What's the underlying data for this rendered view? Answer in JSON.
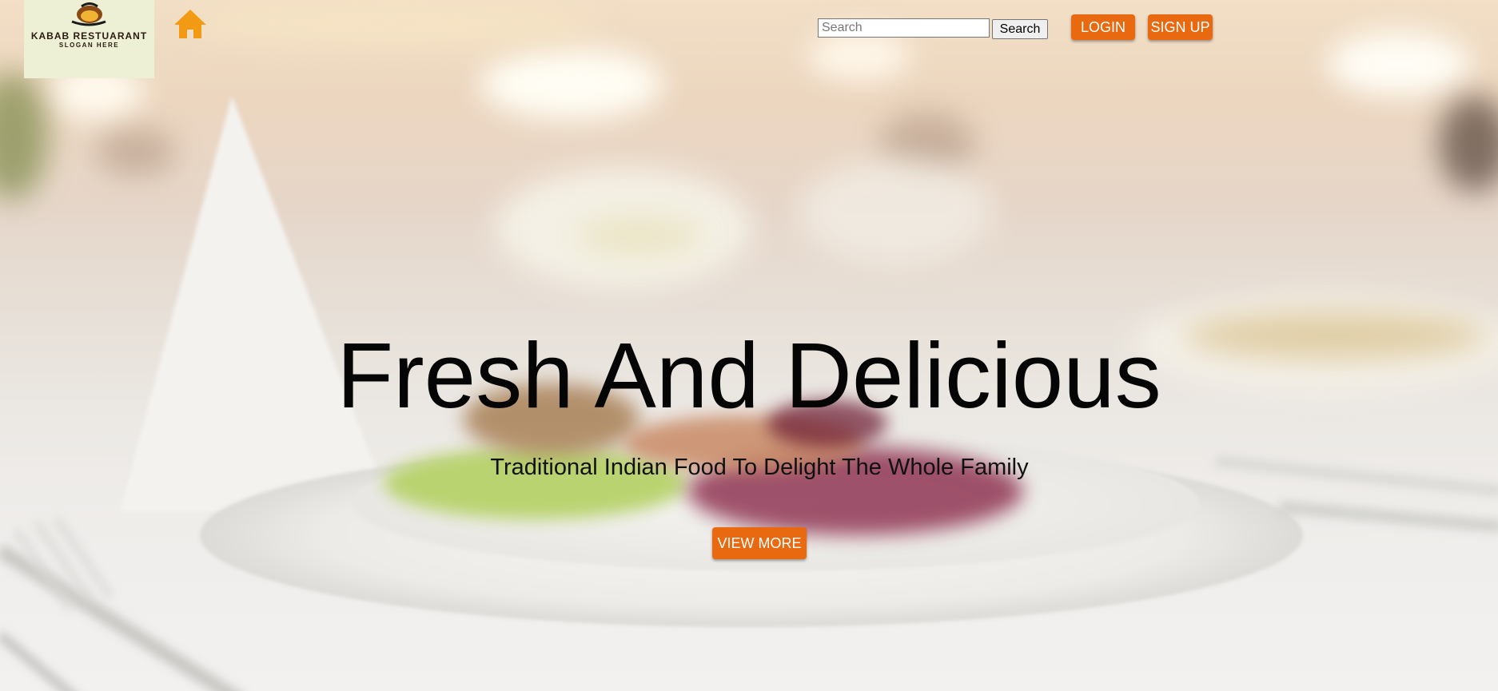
{
  "brand": {
    "name": "KABAB RESTUARANT",
    "slogan": "SLOGAN HERE",
    "logo_icon": "kabab-dish-icon"
  },
  "nav": {
    "home_icon": "home-icon"
  },
  "search": {
    "placeholder": "Search",
    "value": "",
    "button_label": "Search"
  },
  "auth": {
    "login_label": "LOGIN",
    "signup_label": "SIGN UP"
  },
  "hero": {
    "title": "Fresh And Delicious",
    "subtitle": "Traditional Indian Food To Delight The Whole Family",
    "cta_label": "VIEW MORE",
    "background": "restaurant-table-salad-plate-photo"
  },
  "colors": {
    "accent": "#e8690f",
    "home_icon": "#f39a14",
    "logo_bg": "#eef0d6"
  }
}
